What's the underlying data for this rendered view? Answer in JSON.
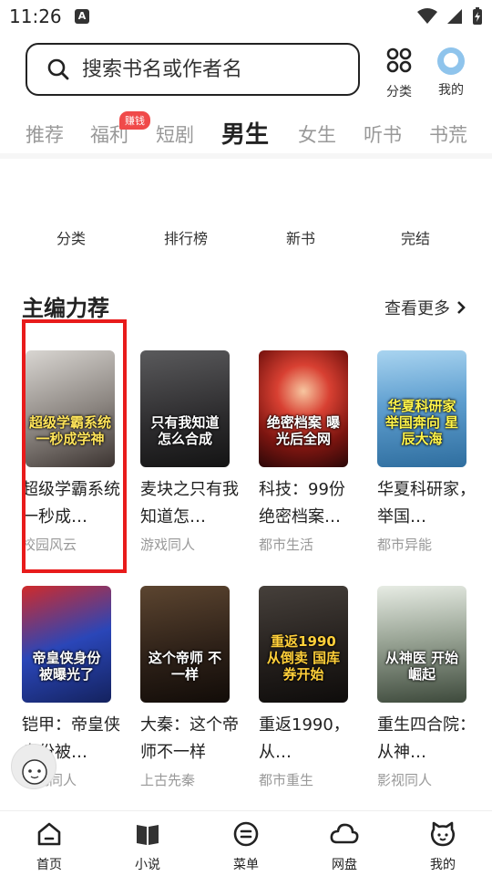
{
  "status": {
    "time": "11:26",
    "a_icon": "A"
  },
  "search": {
    "placeholder": "搜索书名或作者名"
  },
  "top_actions": {
    "category_label": "分类",
    "profile_label": "我的"
  },
  "tabs": [
    {
      "label": "推荐"
    },
    {
      "label": "福利"
    },
    {
      "label": "短剧"
    },
    {
      "label": "男生"
    },
    {
      "label": "女生"
    },
    {
      "label": "听书"
    },
    {
      "label": "书荒"
    }
  ],
  "active_tab": "男生",
  "welfare_badge": "赚钱",
  "quick_nav": [
    {
      "label": "分类"
    },
    {
      "label": "排行榜"
    },
    {
      "label": "新书"
    },
    {
      "label": "完结"
    }
  ],
  "section": {
    "title": "主编力荐",
    "more": "查看更多"
  },
  "books": [
    {
      "cover_text": "超级学霸系统 一秒成学神",
      "title": "超级学霸系统一秒成…",
      "genre": "校园风云",
      "color": "#9a9590"
    },
    {
      "cover_text": "只有我知道 怎么合成",
      "title": "麦块之只有我知道怎…",
      "genre": "游戏同人",
      "color": "#3b3a3c"
    },
    {
      "cover_text": "绝密档案 曝光后全网",
      "title": "科技：99份绝密档案…",
      "genre": "都市生活",
      "color": "#a8241f"
    },
    {
      "cover_text": "华夏科研家 举国奔向 星辰大海",
      "title": "华夏科研家，举国…",
      "genre": "都市异能",
      "color": "#4b8fc4"
    },
    {
      "cover_text": "帝皇侠身份 被曝光了",
      "title": "铠甲：帝皇侠身份被…",
      "genre": "影视同人",
      "color": "#2440a0"
    },
    {
      "cover_text": "这个帝师 不一样",
      "title": "大秦：这个帝师不一样",
      "genre": "上古先秦",
      "color": "#3b2a1c"
    },
    {
      "cover_text": "重返1990 从倒卖 国库券开始",
      "title": "重返1990，从…",
      "genre": "都市重生",
      "color": "#2b2622"
    },
    {
      "cover_text": "从神医 开始崛起",
      "title": "重生四合院：从神…",
      "genre": "影视同人",
      "color": "#6f7b6e"
    }
  ],
  "bottom_nav": [
    {
      "label": "首页"
    },
    {
      "label": "小说"
    },
    {
      "label": "菜单"
    },
    {
      "label": "网盘"
    },
    {
      "label": "我的"
    }
  ]
}
